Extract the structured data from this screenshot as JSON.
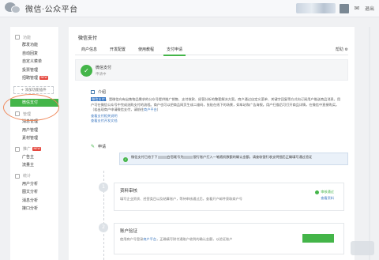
{
  "app": {
    "title": "微信·公众平台",
    "logout_label": "退出"
  },
  "sidebar": {
    "groups": [
      {
        "title": "功能",
        "items": [
          "群发功能",
          "自动回复",
          "自定义菜单",
          "投票管理",
          "招聘管理"
        ],
        "badge_item": "招聘管理",
        "badge": "NEW"
      },
      {
        "title": "管理",
        "items": [
          "消息管理",
          "用户管理",
          "素材管理"
        ]
      },
      {
        "title": "推广",
        "badge": "NEW",
        "items": [
          "广告主",
          "流量主"
        ]
      },
      {
        "title": "统计",
        "items": [
          "用户分析",
          "图文分析",
          "消息分析",
          "接口分析"
        ]
      }
    ],
    "add_plugin_label": "+ 添加功能插件",
    "active_item": "微信支付"
  },
  "main": {
    "page_title": "微信支付",
    "tabs": [
      "商户信息",
      "开发配置",
      "使用教程",
      "支付申请"
    ],
    "active_tab": "支付申请",
    "help_label": "帮助",
    "status": {
      "title": "微信支付",
      "subtitle": "申请中"
    },
    "intro": {
      "heading": "介绍",
      "highlight": "微信支付",
      "body": "，是微信向有出售物品需求的公众号提供推广销售、支付收款、经营分析的整套解决方案。商户通过自定义菜单、关键字回复等方式向订阅用户推送商品消息，用户可在微信公众号中完成选购支付的流程。商户也可以把商品网页生成二维码，张贴在线下的场景，如车站和广告海报。用户扫描后可打开商品详情，在微信中直接购买。（若出现商户申请微信支付，请前往",
      "body_link": "商户平台",
      "body_tail": "）",
      "links": [
        "查看支付相关说明",
        "查看支付开发文档"
      ]
    },
    "apply": {
      "heading": "申请",
      "notice_a": "微信支付已给于下",
      "notice_b": "台您尾号为",
      "notice_c": "银行账户打入一笔随机数额的确认金额，请查收银行收支明细后正确填写通过验证"
    },
    "steps": [
      {
        "num": "1",
        "title": "资料审核",
        "desc": "填写企业资质、经营类目以及结算账户，等待审核通过后，查看开户邮件获取商户号",
        "status": "审核通过",
        "status_link": "查看资料"
      },
      {
        "num": "2",
        "title": "账户验证",
        "desc_a": "使用商户号登录",
        "desc_link": "商户平台",
        "desc_b": "，正确填写财付通账户收到的确认金额，以验证账户"
      }
    ]
  },
  "colors": {
    "accent": "#44b549",
    "link": "#3b77c0",
    "highlight": "#2f72c2",
    "annotation": "#f08a5d"
  },
  "icons": {
    "pay": "wechat-pay-icon",
    "check": "check-circle-icon",
    "pen": "pen-icon",
    "gear": "gear-icon"
  }
}
